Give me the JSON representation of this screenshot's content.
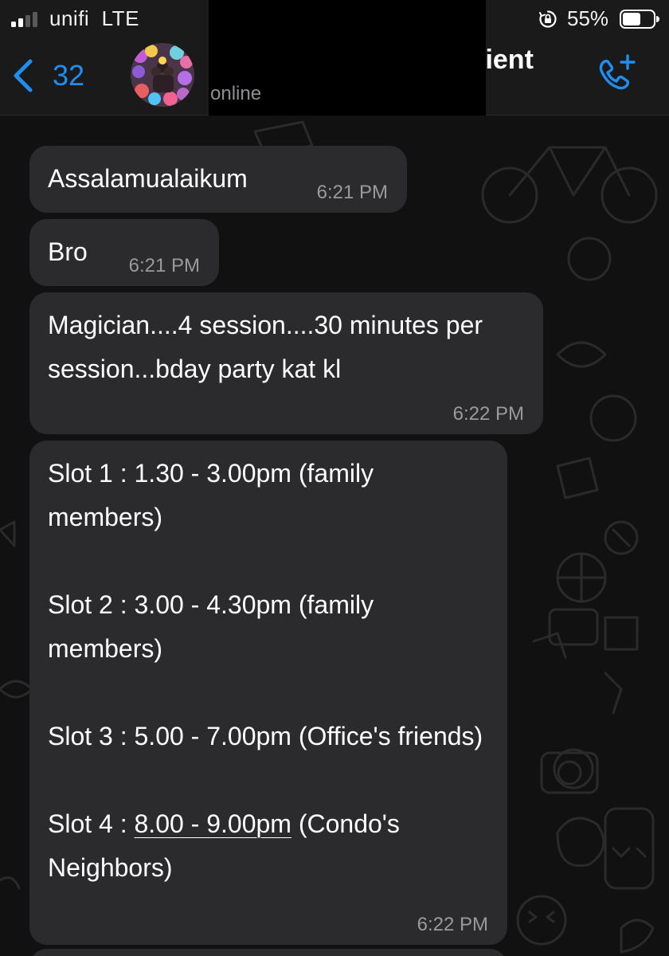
{
  "status_bar": {
    "carrier": "unifi",
    "network": "LTE",
    "battery_percent": "55%"
  },
  "header": {
    "back_count": "32",
    "contact_name_visible": "lient",
    "contact_status": "online"
  },
  "messages": [
    {
      "text": "Assalamualaikum",
      "time": "6:21 PM"
    },
    {
      "text": "Bro",
      "time": "6:21 PM"
    },
    {
      "text": "Magician....4 session....30 minutes per session...bday party kat kl",
      "time": "6:22 PM"
    },
    {
      "lines": [
        "Slot 1 : 1.30 - 3.00pm (family members)",
        "Slot 2 : 3.00 - 4.30pm  (family members)",
        "Slot 3 : 5.00 - 7.00pm (Office's friends)"
      ],
      "slot4_prefix": "Slot 4 : ",
      "slot4_link": "8.00 - 9.00pm",
      "slot4_suffix": " (Condo's Neighbors)",
      "time": "6:22 PM"
    }
  ],
  "colors": {
    "accent": "#1f8ef1",
    "bubble": "#2b2b2d",
    "background": "#111111"
  },
  "icons": {
    "back": "chevron-left-icon",
    "call": "phone-plus-icon",
    "rotation_lock": "rotation-lock-icon",
    "battery": "battery-icon",
    "signal": "signal-bars-icon"
  }
}
